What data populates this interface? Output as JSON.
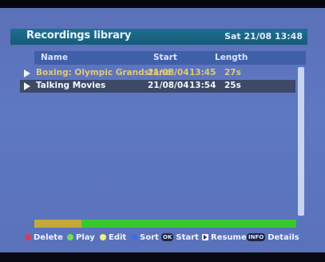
{
  "header": {
    "title": "Recordings library",
    "datetime": "Sat 21/08 13:48"
  },
  "columns": {
    "name": "Name",
    "start": "Start",
    "length": "Length"
  },
  "recordings": [
    {
      "name": "Boxing: Olympic Grandstand",
      "date": "21/08/04",
      "time": "13:45",
      "length": "27s"
    },
    {
      "name": "Talking Movies",
      "date": "21/08/04",
      "time": "13:54",
      "length": "25s",
      "selected": true
    }
  ],
  "disk_usage": {
    "used_fraction": 0.18,
    "used_color": "#c3a93b",
    "free_color": "#37c82f"
  },
  "footer": {
    "delete": {
      "label": "Delete",
      "color": "#d63c5d"
    },
    "play": {
      "label": "Play",
      "color": "#6fe04c"
    },
    "edit": {
      "label": "Edit",
      "color": "#f2f07a"
    },
    "sort": {
      "label": "Sort",
      "color": "#3f6fe0"
    },
    "start": {
      "key": "OK",
      "label": "Start"
    },
    "resume": {
      "label": "Resume"
    },
    "details": {
      "key": "INFO",
      "label": "Details"
    }
  }
}
